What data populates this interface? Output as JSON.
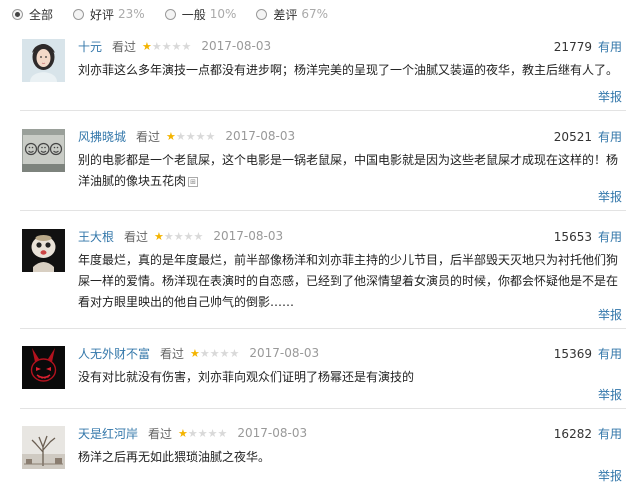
{
  "filters": [
    {
      "label": "全部",
      "pct": ""
    },
    {
      "label": "好评",
      "pct": "23%"
    },
    {
      "label": "一般",
      "pct": "10%"
    },
    {
      "label": "差评",
      "pct": "67%"
    }
  ],
  "selected_filter": "全部",
  "useful_label": "有用",
  "report_label": "举报",
  "rated_label": "看过",
  "rating_stars": "★★★★★",
  "reviews": [
    {
      "user": "十元",
      "rating": 1,
      "date": "2017-08-03",
      "votes": "21779",
      "text": "刘亦菲这么多年演技一点都没有进步啊；杨洋完美的呈现了一个油腻又装逼的夜华，教主后继有人了。",
      "avatar_icon": "girl-portrait-avatar"
    },
    {
      "user": "风拂晓城",
      "rating": 1,
      "date": "2017-08-03",
      "votes": "20521",
      "text": "别的电影都是一个老鼠屎，这个电影是一锅老鼠屎，中国电影就是因为这些老鼠屎才成现在这样的！杨洋油腻的像块五花肉",
      "expand": "⊞",
      "avatar_icon": "smiley-faces-avatar"
    },
    {
      "user": "王大根",
      "rating": 1,
      "date": "2017-08-03",
      "votes": "15653",
      "text": "年度最烂，真的是年度最烂，前半部像杨洋和刘亦菲主持的少儿节目，后半部毁天灭地只为衬托他们狗屎一样的爱情。杨洋现在表演时的自恋感，已经到了他深情望着女演员的时候，你都会怀疑他是不是在看对方眼里映出的他自己帅气的倒影……",
      "avatar_icon": "doll-avatar"
    },
    {
      "user": "人无外财不富",
      "rating": 1,
      "date": "2017-08-03",
      "votes": "15369",
      "text": "没有对比就没有伤害，刘亦菲向观众们证明了杨幂还是有演技的",
      "avatar_icon": "red-bunny-mask-avatar"
    },
    {
      "user": "天是红河岸",
      "rating": 1,
      "date": "2017-08-03",
      "votes": "16282",
      "text": "杨洋之后再无如此猥琐油腻之夜华。",
      "avatar_icon": "winter-tree-avatar"
    }
  ],
  "colors": {
    "link": "#3377aa",
    "star": "#f4b400",
    "star_off": "#d9d9d9"
  }
}
